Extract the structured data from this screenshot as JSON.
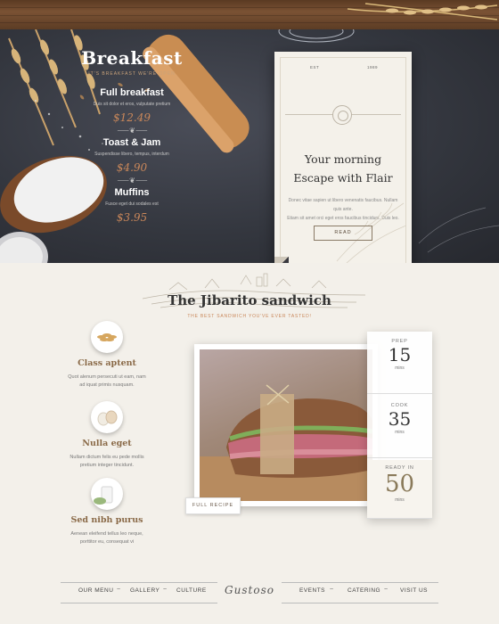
{
  "hero": {
    "menu": {
      "title": "Breakfast",
      "subtitle": "IT'S BREAKFAST WE'RE OPEN",
      "items": [
        {
          "name": "Full breakfast",
          "desc": "Duis sit dolor et eros, vulputate pretium",
          "price": "$12.49"
        },
        {
          "name": "Toast & Jam",
          "desc": "Suspendisse libero, tempus, interdum",
          "price": "$4.90"
        },
        {
          "name": "Muffins",
          "desc": "Fusce eget dui sodales est",
          "price": "$3.95"
        }
      ]
    },
    "card": {
      "est_label": "EST",
      "year": "1989",
      "heading_line1": "Your morning",
      "heading_line2": "Escape with Flair",
      "body_line1": "Donec vitae sapien ut libero venenatis faucibus. Nullam quis ante.",
      "body_line2": "Etiam sit amet orci eget eros faucibus tincidunt. Duis leo.",
      "button_label": "READ"
    }
  },
  "section": {
    "title": "The Jibarito sandwich",
    "subtitle": "THE BEST SANDWICH YOU'VE EVER TASTED!"
  },
  "features": [
    {
      "title": "Class aptent",
      "desc_line1": "Quot alenum persecuti ut eam, nam",
      "desc_line2": "ad iquat primis nusquam.",
      "icon": "wheat-icon"
    },
    {
      "title": "Nulla eget",
      "desc_line1": "Nullam dictum felis eu pede mollis",
      "desc_line2": "pretium integer tincidunt.",
      "icon": "eggs-icon"
    },
    {
      "title": "Sed nibh purus",
      "desc_line1": "Aenean eleifend tellus leo neque,",
      "desc_line2": "porttitor eu, consequat vi",
      "icon": "milk-icon"
    }
  ],
  "recipe": {
    "full_recipe_label": "FULL RECIPE",
    "prep_label": "PREP",
    "prep_value": "15",
    "prep_unit": "mins",
    "cook_label": "COOK",
    "cook_value": "35",
    "cook_unit": "mins",
    "ready_label": "READY IN",
    "ready_value": "50",
    "ready_unit": "mins"
  },
  "footer": {
    "nav_left": [
      "OUR MENU",
      "GALLERY",
      "CULTURE"
    ],
    "nav_right": [
      "EVENTS",
      "CATERING",
      "VISIT US"
    ],
    "separator": "~",
    "logo": "Gustoso"
  }
}
